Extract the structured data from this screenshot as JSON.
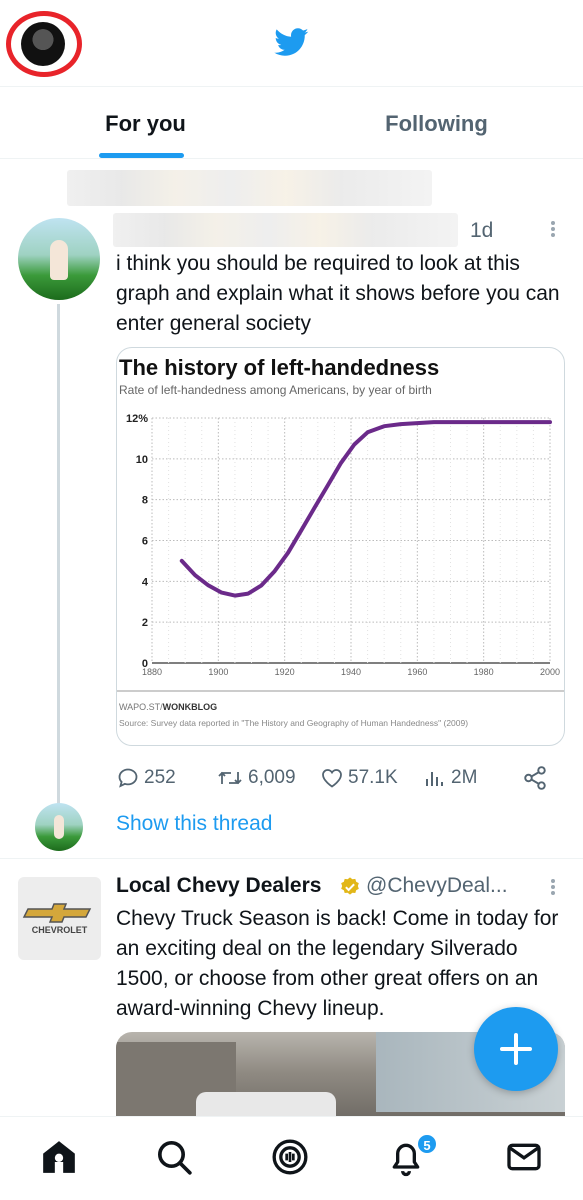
{
  "header": {
    "logo": "twitter-bird-icon",
    "profile_avatar": "user-avatar"
  },
  "tabs": [
    {
      "label": "For you",
      "active": true
    },
    {
      "label": "Following",
      "active": false
    }
  ],
  "tweet1": {
    "time": "1d",
    "text": "i think you should be required to look at this graph and explain what it shows before you can enter general society",
    "stats": {
      "replies": "252",
      "retweets": "6,009",
      "likes": "57.1K",
      "views": "2M"
    },
    "show_thread": "Show this thread"
  },
  "chart_card": {
    "chart_data": {
      "type": "line",
      "title": "The history of left-handedness",
      "subtitle": "Rate of left-handedness among Americans, by year of birth",
      "xlabel": "",
      "ylabel": "",
      "x_ticks": [
        "1880",
        "1900",
        "1920",
        "1940",
        "1960",
        "1980",
        "2000"
      ],
      "y_ticks": [
        "0",
        "2",
        "4",
        "6",
        "8",
        "10",
        "12%"
      ],
      "xlim": [
        1880,
        2000
      ],
      "ylim": [
        0,
        12
      ],
      "grid": true,
      "series": [
        {
          "x": [
            1889,
            1893,
            1897,
            1901,
            1905,
            1909,
            1913,
            1917,
            1921,
            1925,
            1929,
            1933,
            1937,
            1941,
            1945,
            1950,
            1955,
            1960,
            1965,
            1970,
            1980,
            1990,
            2000
          ],
          "values": [
            5.0,
            4.3,
            3.8,
            3.45,
            3.3,
            3.4,
            3.8,
            4.5,
            5.4,
            6.5,
            7.6,
            8.7,
            9.8,
            10.7,
            11.3,
            11.6,
            11.7,
            11.75,
            11.8,
            11.8,
            11.8,
            11.8,
            11.8
          ]
        }
      ],
      "source_label": "WAPO.ST/",
      "source_brand": "WONKBLOG",
      "source_note": "Source: Survey data reported in \"The History and Geography of Human Handedness\" (2009)"
    }
  },
  "ad": {
    "name": "Local Chevy Dealers",
    "handle": "@ChevyDeal...",
    "logo_text": "CHEVROLET",
    "text": "Chevy Truck Season is back! Come in today for an exciting deal on the legendary Silverado 1500, or choose from other great offers on an award-winning Chevy lineup."
  },
  "fab": {
    "icon": "plus-icon"
  },
  "bottom_nav": {
    "items": [
      "home-icon",
      "search-icon",
      "spaces-icon",
      "notifications-icon",
      "messages-icon"
    ],
    "notification_badge": "5"
  },
  "colors": {
    "accent": "#1d9bf0",
    "chart_line": "#6b2a8a",
    "highlight_ring": "#e8242a"
  }
}
